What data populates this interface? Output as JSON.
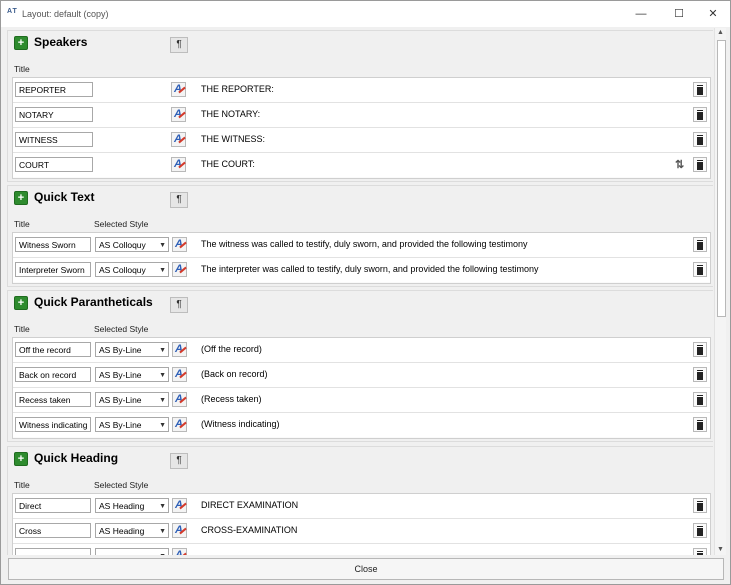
{
  "window": {
    "app_icon_text": "A T",
    "title": "Layout: default (copy)",
    "minimize_glyph": "—",
    "maximize_glyph": "☐",
    "close_glyph": "✕"
  },
  "col_title": "Title",
  "col_style": "Selected Style",
  "para_icon": "¶",
  "speakers": {
    "title": "Speakers",
    "rows": [
      {
        "title": "REPORTER",
        "text": "THE REPORTER:"
      },
      {
        "title": "NOTARY",
        "text": "THE NOTARY:"
      },
      {
        "title": "WITNESS",
        "text": "THE WITNESS:"
      },
      {
        "title": "COURT",
        "text": "THE COURT:"
      }
    ]
  },
  "quick_text": {
    "title": "Quick Text",
    "rows": [
      {
        "title": "Witness Sworn",
        "style": "AS Colloquy",
        "text": "The witness was called to testify, duly sworn, and provided the following testimony"
      },
      {
        "title": "Interpreter Sworn",
        "style": "AS Colloquy",
        "text": "The interpreter was called to testify, duly sworn, and provided the following testimony"
      }
    ]
  },
  "quick_parentheticals": {
    "title": "Quick Parantheticals",
    "rows": [
      {
        "title": "Off the record",
        "style": "AS By-Line",
        "text": "(Off the record)"
      },
      {
        "title": "Back on record",
        "style": "AS By-Line",
        "text": "(Back on record)"
      },
      {
        "title": "Recess taken",
        "style": "AS By-Line",
        "text": "(Recess taken)"
      },
      {
        "title": "Witness indicating",
        "style": "AS By-Line",
        "text": "(Witness indicating)"
      }
    ]
  },
  "quick_heading": {
    "title": "Quick Heading",
    "rows": [
      {
        "title": "Direct",
        "style": "AS Heading",
        "text": "DIRECT EXAMINATION"
      },
      {
        "title": "Cross",
        "style": "AS Heading",
        "text": "CROSS-EXAMINATION"
      }
    ]
  },
  "close_label": "Close",
  "colors": {
    "add": "#2e8b2e",
    "style_icon": "#2e5fb7"
  }
}
